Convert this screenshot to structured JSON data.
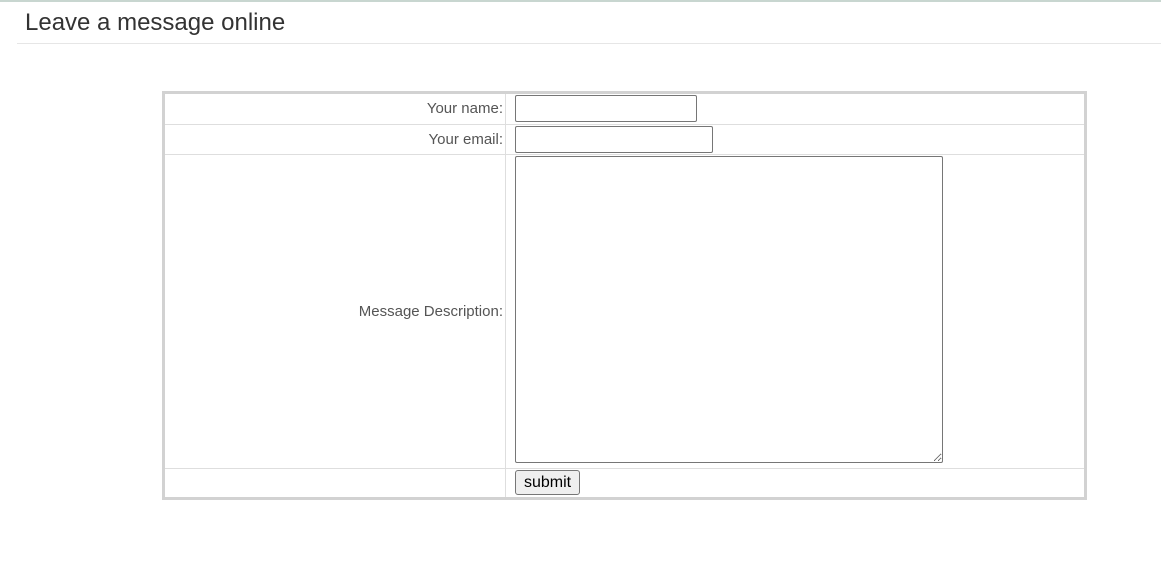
{
  "header": {
    "title": "Leave a message online"
  },
  "form": {
    "name_label": "Your name:",
    "name_value": "",
    "email_label": "Your email:",
    "email_value": "",
    "message_label": "Message Description:",
    "message_value": "",
    "submit_label": "submit"
  }
}
